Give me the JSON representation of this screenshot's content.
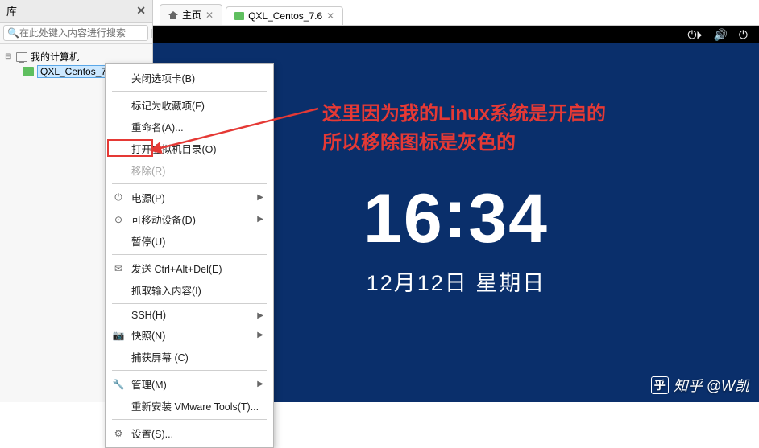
{
  "sidebar": {
    "title": "库",
    "search_placeholder": "在此处键入内容进行搜索",
    "root": {
      "label": "我的计算机"
    },
    "vm": {
      "label": "QXL_Centos_7.6"
    }
  },
  "tabs": {
    "home": "主页",
    "vm": "QXL_Centos_7.6"
  },
  "clock": {
    "hours": "16",
    "minutes": "34",
    "date": "12月12日 星期日"
  },
  "annotation": {
    "line1": "这里因为我的Linux系统是开启的",
    "line2": "所以移除图标是灰色的"
  },
  "context_menu": {
    "close_tab": "关闭选项卡(B)",
    "mark_fav": "标记为收藏项(F)",
    "rename": "重命名(A)...",
    "open_vmdir": "打开虚拟机目录(O)",
    "remove": "移除(R)",
    "power": "电源(P)",
    "removable": "可移动设备(D)",
    "pause": "暂停(U)",
    "sendcad": "发送 Ctrl+Alt+Del(E)",
    "grab_input": "抓取输入内容(I)",
    "ssh": "SSH(H)",
    "snapshot": "快照(N)",
    "capture": "捕获屏幕 (C)",
    "manage": "管理(M)",
    "reinstall_tools": "重新安装 VMware Tools(T)...",
    "settings": "设置(S)..."
  },
  "watermark": "知乎 @W凯"
}
